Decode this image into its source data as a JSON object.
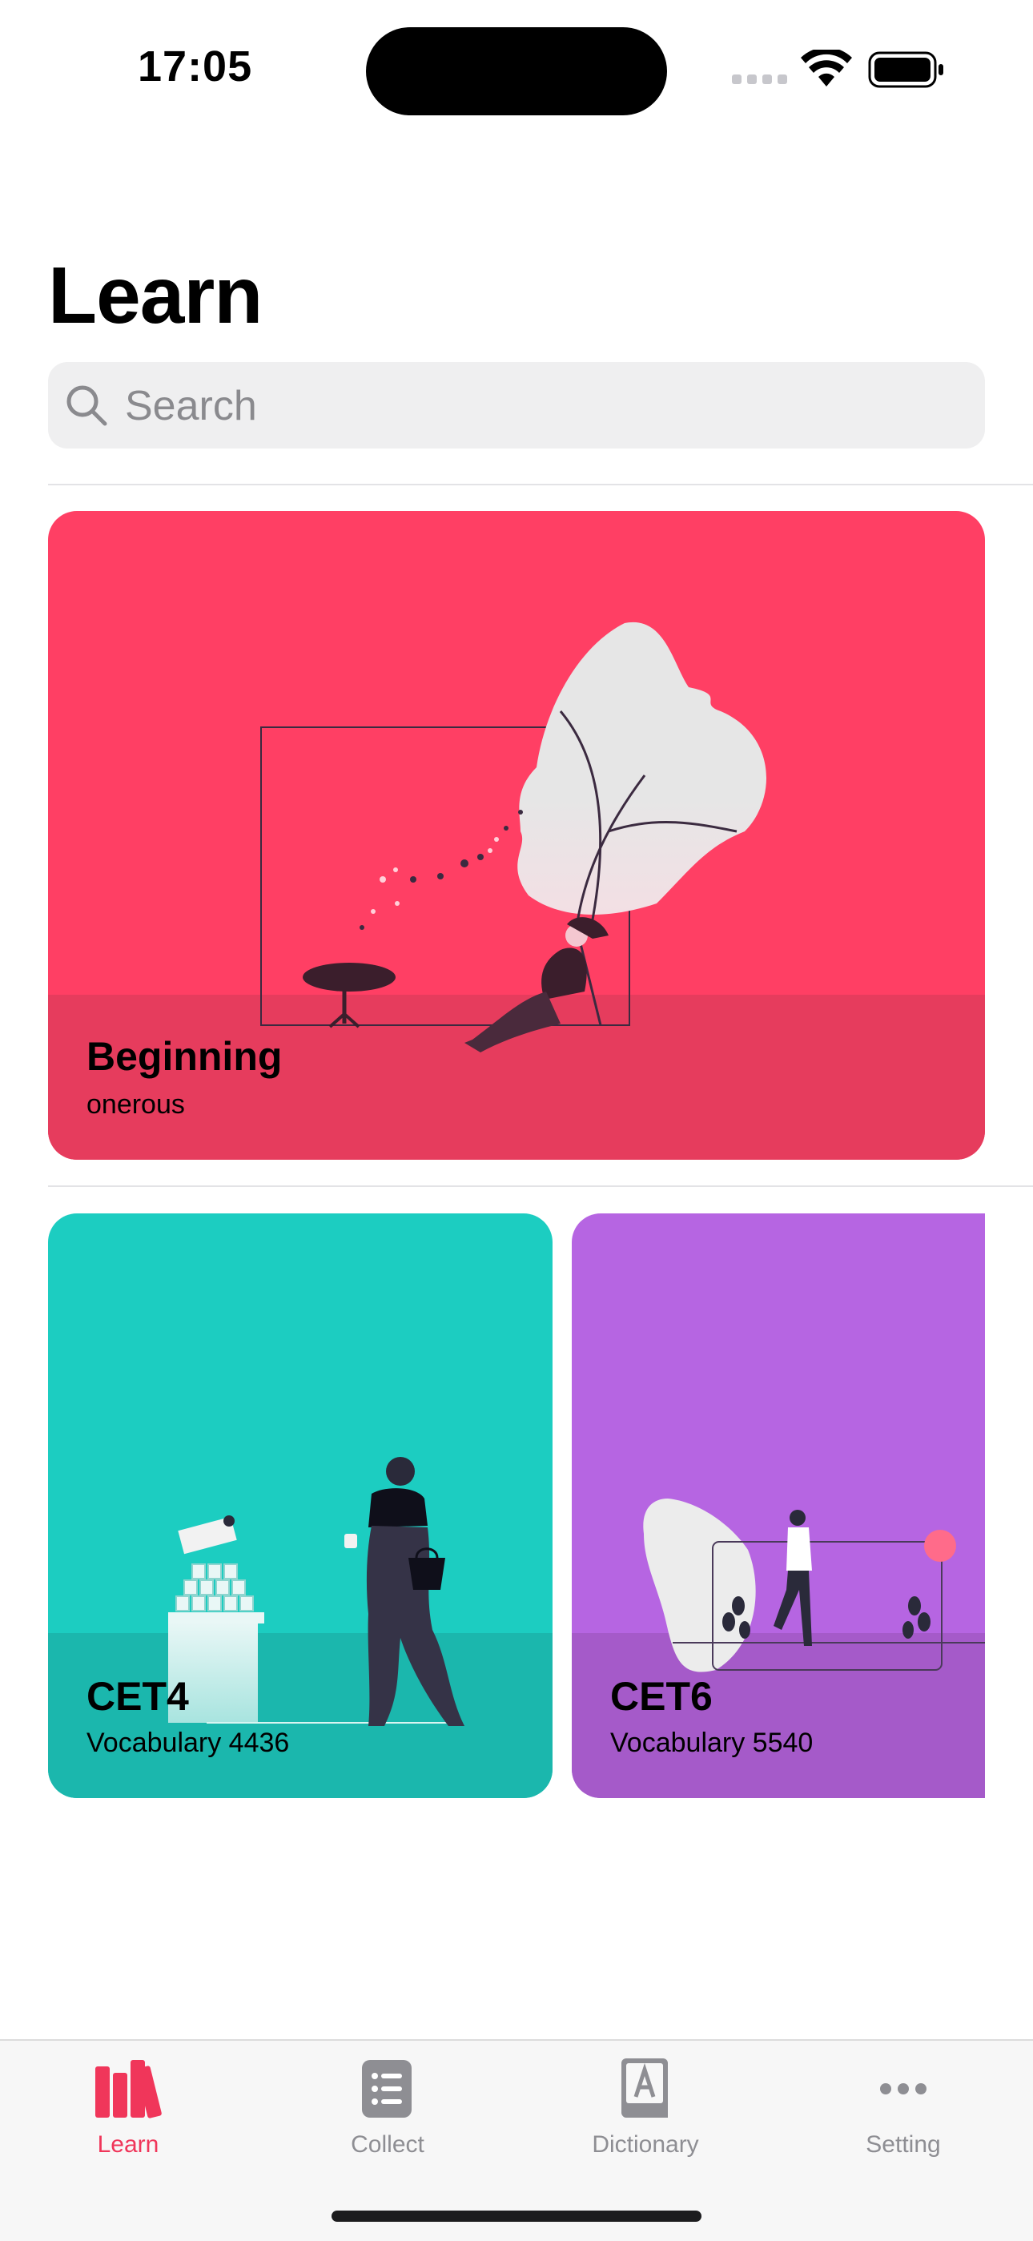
{
  "status_bar": {
    "time": "17:05"
  },
  "header": {
    "title": "Learn"
  },
  "search": {
    "placeholder": "Search"
  },
  "featured_card": {
    "title": "Beginning",
    "subtitle": "onerous",
    "color": "#ff3f64",
    "band_color": "#e63c5d"
  },
  "cards": [
    {
      "title": "CET4",
      "subtitle": "Vocabulary 4436",
      "color": "#1ccdc1",
      "band_color": "#1bb7ad"
    },
    {
      "title": "CET6",
      "subtitle": "Vocabulary 5540",
      "color": "#b665e2",
      "band_color": "#a55ac9"
    }
  ],
  "tabs": [
    {
      "label": "Learn",
      "icon": "books-icon",
      "active": true
    },
    {
      "label": "Collect",
      "icon": "list-icon",
      "active": false
    },
    {
      "label": "Dictionary",
      "icon": "dictionary-icon",
      "active": false
    },
    {
      "label": "Setting",
      "icon": "more-icon",
      "active": false
    }
  ],
  "colors": {
    "accent": "#f0365a",
    "inactive": "#8e8e93"
  }
}
